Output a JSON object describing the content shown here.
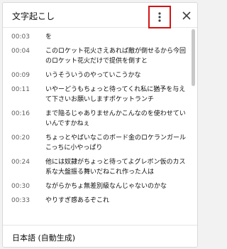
{
  "panel": {
    "title": "文字起こし",
    "footer_language": "日本語 (自動生成)"
  },
  "icons": {
    "menu": "more-vertical-icon",
    "close": "close-icon"
  },
  "colors": {
    "highlight_box": "#d21414",
    "timestamp": "#606060"
  },
  "transcript": [
    {
      "time": "00:03",
      "text": "を"
    },
    {
      "time": "00:04",
      "text": "このロケット花火さえあれば敵が倒せるから今回のロケット花火だけで提供を倒すと"
    },
    {
      "time": "00:09",
      "text": "いうそういうのやっていこうかな"
    },
    {
      "time": "00:11",
      "text": "いやーどうもちょっと待ってくれ私に猶予を与えて下さいお願いしますポケットランチ"
    },
    {
      "time": "00:16",
      "text": "まで陥るじゃありませんかこんなのを使わせていいんですかねぇ"
    },
    {
      "time": "00:20",
      "text": "ちょっとやばいなこのボード金のロケランガールこっちに小やっぱり"
    },
    {
      "time": "00:24",
      "text": "他には奴隷がちょっと待ってよグレボン仮のカス系な大盤振る舞いだねこれ作った人は"
    },
    {
      "time": "00:30",
      "text": "ながらかちょ無差別級なんじゃないのかな"
    },
    {
      "time": "00:33",
      "text": "やりすぎ感あるぞこれ"
    }
  ]
}
